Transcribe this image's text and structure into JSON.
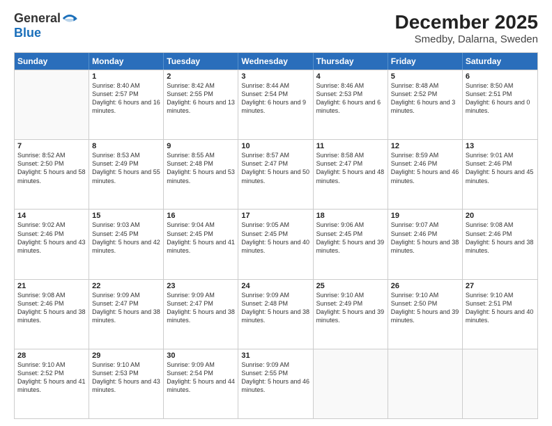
{
  "header": {
    "logo_line1": "General",
    "logo_line2": "Blue",
    "month_year": "December 2025",
    "location": "Smedby, Dalarna, Sweden"
  },
  "days_of_week": [
    "Sunday",
    "Monday",
    "Tuesday",
    "Wednesday",
    "Thursday",
    "Friday",
    "Saturday"
  ],
  "weeks": [
    [
      {
        "day": "",
        "sunrise": "",
        "sunset": "",
        "daylight": "",
        "empty": true
      },
      {
        "day": "1",
        "sunrise": "Sunrise: 8:40 AM",
        "sunset": "Sunset: 2:57 PM",
        "daylight": "Daylight: 6 hours and 16 minutes."
      },
      {
        "day": "2",
        "sunrise": "Sunrise: 8:42 AM",
        "sunset": "Sunset: 2:55 PM",
        "daylight": "Daylight: 6 hours and 13 minutes."
      },
      {
        "day": "3",
        "sunrise": "Sunrise: 8:44 AM",
        "sunset": "Sunset: 2:54 PM",
        "daylight": "Daylight: 6 hours and 9 minutes."
      },
      {
        "day": "4",
        "sunrise": "Sunrise: 8:46 AM",
        "sunset": "Sunset: 2:53 PM",
        "daylight": "Daylight: 6 hours and 6 minutes."
      },
      {
        "day": "5",
        "sunrise": "Sunrise: 8:48 AM",
        "sunset": "Sunset: 2:52 PM",
        "daylight": "Daylight: 6 hours and 3 minutes."
      },
      {
        "day": "6",
        "sunrise": "Sunrise: 8:50 AM",
        "sunset": "Sunset: 2:51 PM",
        "daylight": "Daylight: 6 hours and 0 minutes."
      }
    ],
    [
      {
        "day": "7",
        "sunrise": "Sunrise: 8:52 AM",
        "sunset": "Sunset: 2:50 PM",
        "daylight": "Daylight: 5 hours and 58 minutes."
      },
      {
        "day": "8",
        "sunrise": "Sunrise: 8:53 AM",
        "sunset": "Sunset: 2:49 PM",
        "daylight": "Daylight: 5 hours and 55 minutes."
      },
      {
        "day": "9",
        "sunrise": "Sunrise: 8:55 AM",
        "sunset": "Sunset: 2:48 PM",
        "daylight": "Daylight: 5 hours and 53 minutes."
      },
      {
        "day": "10",
        "sunrise": "Sunrise: 8:57 AM",
        "sunset": "Sunset: 2:47 PM",
        "daylight": "Daylight: 5 hours and 50 minutes."
      },
      {
        "day": "11",
        "sunrise": "Sunrise: 8:58 AM",
        "sunset": "Sunset: 2:47 PM",
        "daylight": "Daylight: 5 hours and 48 minutes."
      },
      {
        "day": "12",
        "sunrise": "Sunrise: 8:59 AM",
        "sunset": "Sunset: 2:46 PM",
        "daylight": "Daylight: 5 hours and 46 minutes."
      },
      {
        "day": "13",
        "sunrise": "Sunrise: 9:01 AM",
        "sunset": "Sunset: 2:46 PM",
        "daylight": "Daylight: 5 hours and 45 minutes."
      }
    ],
    [
      {
        "day": "14",
        "sunrise": "Sunrise: 9:02 AM",
        "sunset": "Sunset: 2:46 PM",
        "daylight": "Daylight: 5 hours and 43 minutes."
      },
      {
        "day": "15",
        "sunrise": "Sunrise: 9:03 AM",
        "sunset": "Sunset: 2:45 PM",
        "daylight": "Daylight: 5 hours and 42 minutes."
      },
      {
        "day": "16",
        "sunrise": "Sunrise: 9:04 AM",
        "sunset": "Sunset: 2:45 PM",
        "daylight": "Daylight: 5 hours and 41 minutes."
      },
      {
        "day": "17",
        "sunrise": "Sunrise: 9:05 AM",
        "sunset": "Sunset: 2:45 PM",
        "daylight": "Daylight: 5 hours and 40 minutes."
      },
      {
        "day": "18",
        "sunrise": "Sunrise: 9:06 AM",
        "sunset": "Sunset: 2:45 PM",
        "daylight": "Daylight: 5 hours and 39 minutes."
      },
      {
        "day": "19",
        "sunrise": "Sunrise: 9:07 AM",
        "sunset": "Sunset: 2:46 PM",
        "daylight": "Daylight: 5 hours and 38 minutes."
      },
      {
        "day": "20",
        "sunrise": "Sunrise: 9:08 AM",
        "sunset": "Sunset: 2:46 PM",
        "daylight": "Daylight: 5 hours and 38 minutes."
      }
    ],
    [
      {
        "day": "21",
        "sunrise": "Sunrise: 9:08 AM",
        "sunset": "Sunset: 2:46 PM",
        "daylight": "Daylight: 5 hours and 38 minutes."
      },
      {
        "day": "22",
        "sunrise": "Sunrise: 9:09 AM",
        "sunset": "Sunset: 2:47 PM",
        "daylight": "Daylight: 5 hours and 38 minutes."
      },
      {
        "day": "23",
        "sunrise": "Sunrise: 9:09 AM",
        "sunset": "Sunset: 2:47 PM",
        "daylight": "Daylight: 5 hours and 38 minutes."
      },
      {
        "day": "24",
        "sunrise": "Sunrise: 9:09 AM",
        "sunset": "Sunset: 2:48 PM",
        "daylight": "Daylight: 5 hours and 38 minutes."
      },
      {
        "day": "25",
        "sunrise": "Sunrise: 9:10 AM",
        "sunset": "Sunset: 2:49 PM",
        "daylight": "Daylight: 5 hours and 39 minutes."
      },
      {
        "day": "26",
        "sunrise": "Sunrise: 9:10 AM",
        "sunset": "Sunset: 2:50 PM",
        "daylight": "Daylight: 5 hours and 39 minutes."
      },
      {
        "day": "27",
        "sunrise": "Sunrise: 9:10 AM",
        "sunset": "Sunset: 2:51 PM",
        "daylight": "Daylight: 5 hours and 40 minutes."
      }
    ],
    [
      {
        "day": "28",
        "sunrise": "Sunrise: 9:10 AM",
        "sunset": "Sunset: 2:52 PM",
        "daylight": "Daylight: 5 hours and 41 minutes."
      },
      {
        "day": "29",
        "sunrise": "Sunrise: 9:10 AM",
        "sunset": "Sunset: 2:53 PM",
        "daylight": "Daylight: 5 hours and 43 minutes."
      },
      {
        "day": "30",
        "sunrise": "Sunrise: 9:09 AM",
        "sunset": "Sunset: 2:54 PM",
        "daylight": "Daylight: 5 hours and 44 minutes."
      },
      {
        "day": "31",
        "sunrise": "Sunrise: 9:09 AM",
        "sunset": "Sunset: 2:55 PM",
        "daylight": "Daylight: 5 hours and 46 minutes."
      },
      {
        "day": "",
        "sunrise": "",
        "sunset": "",
        "daylight": "",
        "empty": true
      },
      {
        "day": "",
        "sunrise": "",
        "sunset": "",
        "daylight": "",
        "empty": true
      },
      {
        "day": "",
        "sunrise": "",
        "sunset": "",
        "daylight": "",
        "empty": true
      }
    ]
  ]
}
